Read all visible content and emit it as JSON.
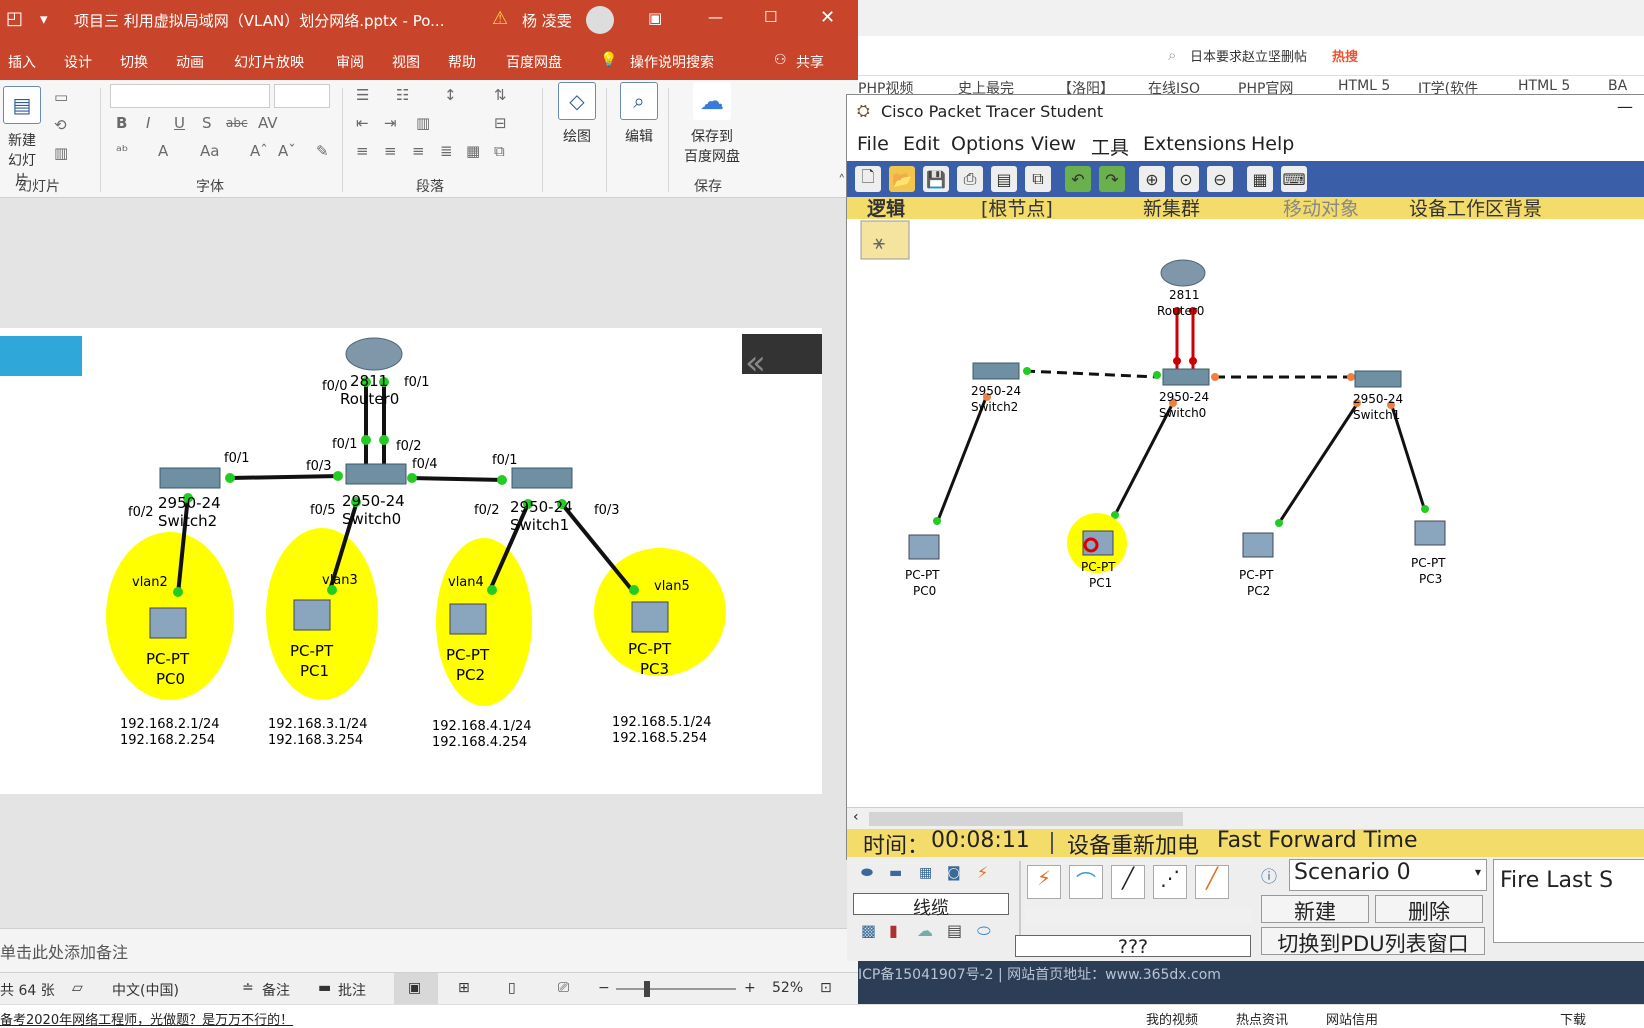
{
  "ppt": {
    "title": "项目三 利用虚拟局域网（VLAN）划分网络.pptx  -  Po...",
    "user": "杨 凌雯",
    "menu": [
      "插入",
      "设计",
      "切换",
      "动画",
      "幻灯片放映",
      "审阅",
      "视图",
      "帮助",
      "百度网盘",
      "操作说明搜索"
    ],
    "share": "共享",
    "ribbon": {
      "new_slide": "新建",
      "new_slide2": "幻灯片",
      "group_slides": "幻灯片",
      "group_font": "字体",
      "group_para": "段落",
      "group_save": "保存",
      "draw": "绘图",
      "edit": "编辑",
      "save_baidu1": "保存到",
      "save_baidu2": "百度网盘"
    },
    "notes": "单击此处添加备注",
    "status": {
      "slides": "共 64 张",
      "lang": "中文(中国)",
      "notes": "备注",
      "comments": "批注",
      "zoom": "52%"
    }
  },
  "slide": {
    "router": {
      "model": "2811",
      "name": "Router0",
      "p1": "f0/0",
      "p2": "f0/1"
    },
    "switches": [
      {
        "model": "2950-24",
        "name": "Switch2"
      },
      {
        "model": "2950-24",
        "name": "Switch0"
      },
      {
        "model": "2950-24",
        "name": "Switch1"
      }
    ],
    "ports": {
      "s0_up1": "f0/1",
      "s0_up2": "f0/2",
      "s0_left": "f0/3",
      "s0_right": "f0/4",
      "s0_down": "f0/5",
      "s2_right": "f0/1",
      "s2_down": "f0/2",
      "s1_left": "f0/1",
      "s1_down": "f0/2",
      "s1_right": "f0/3"
    },
    "pcs": [
      {
        "type": "PC-PT",
        "name": "PC0",
        "vlan": "vlan2",
        "ip": "192.168.2.1/24",
        "gw": "192.168.2.254"
      },
      {
        "type": "PC-PT",
        "name": "PC1",
        "vlan": "vlan3",
        "ip": "192.168.3.1/24",
        "gw": "192.168.3.254"
      },
      {
        "type": "PC-PT",
        "name": "PC2",
        "vlan": "vlan4",
        "ip": "192.168.4.1/24",
        "gw": "192.168.4.254"
      },
      {
        "type": "PC-PT",
        "name": "PC3",
        "vlan": "vlan5",
        "ip": "192.168.5.1/24",
        "gw": "192.168.5.254"
      }
    ]
  },
  "browser": {
    "search_text": "日本要求赵立坚删帖",
    "hot": "热搜",
    "bookmarks": [
      "PHP视频",
      "史上最完",
      "【洛阳】",
      "在线ISO",
      "PHP官网",
      "HTML 5",
      "IT学(软件",
      "HTML 5",
      "BA"
    ],
    "footer": "ICP备15041907号-2 | 网站首页地址：www.365dx.com"
  },
  "pt": {
    "title": "Cisco Packet Tracer Student",
    "menu": [
      "File",
      "Edit",
      "Options",
      "View",
      "工具",
      "Extensions",
      "Help"
    ],
    "tabs": [
      "逻辑",
      "[根节点]",
      "新集群",
      "移动对象",
      "设备工作区背景"
    ],
    "router": {
      "model": "2811",
      "name": "Router0"
    },
    "switches": [
      {
        "model": "2950-24",
        "name": "Switch2"
      },
      {
        "model": "2950-24",
        "name": "Switch0"
      },
      {
        "model": "2950-24",
        "name": "Switch1"
      }
    ],
    "pcs": [
      {
        "type": "PC-PT",
        "name": "PC0"
      },
      {
        "type": "PC-PT",
        "name": "PC1"
      },
      {
        "type": "PC-PT",
        "name": "PC2"
      },
      {
        "type": "PC-PT",
        "name": "PC3"
      }
    ],
    "time_label": "时间：",
    "time": "00:08:11",
    "reset": "设备重新加电",
    "fast_forward": "Fast Forward Time",
    "cable_label": "线缆",
    "unknown": "???",
    "scenario": "Scenario 0",
    "new": "新建",
    "delete": "删除",
    "pdu_toggle": "切换到PDU列表窗口",
    "fire_last": "Fire Last S"
  },
  "ticker": {
    "headline": "备考2020年网络工程师，光做题？是万万不行的！",
    "items": [
      "我的视频",
      "热点资讯",
      "网站信用",
      "下载"
    ]
  },
  "colors": {
    "ppt_red": "#c8452b",
    "pt_yellow": "#f4dc6a",
    "pt_toolbar": "#3a5fa8",
    "vlan_fill": "#ffff00",
    "link_green": "#22cc22"
  }
}
